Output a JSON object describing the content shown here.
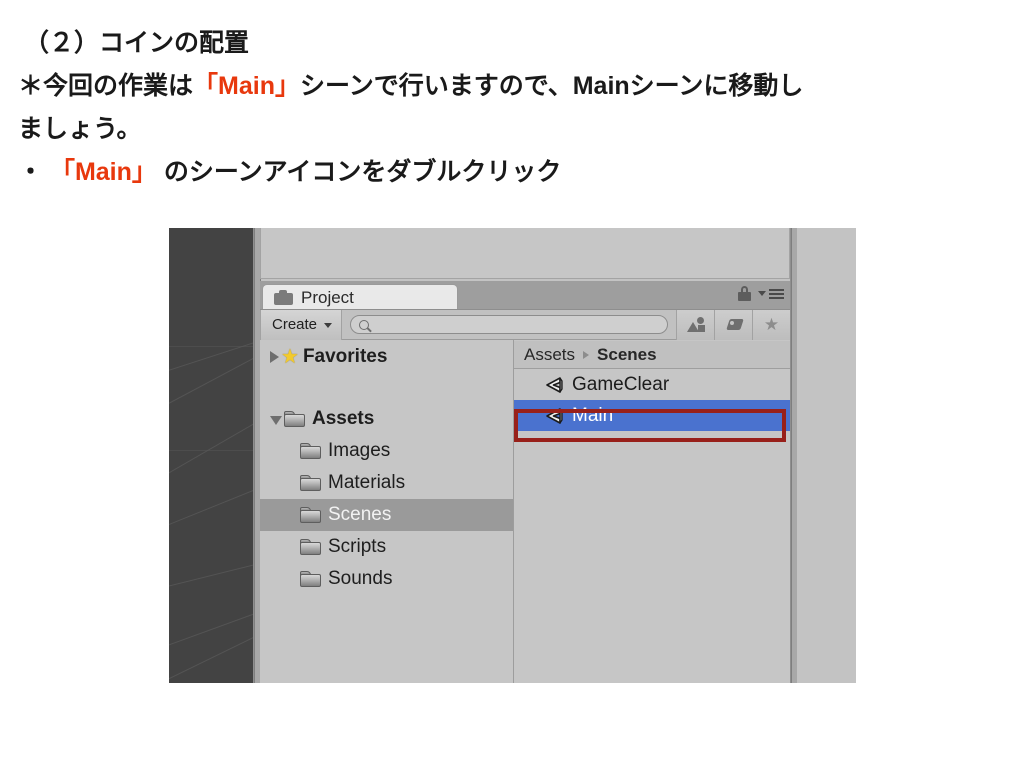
{
  "slide": {
    "lines": [
      {
        "id": "l1",
        "parts": [
          {
            "t": "（２）コインの配置",
            "accent": false
          }
        ]
      },
      {
        "id": "l2",
        "parts": [
          {
            "t": "＊今回の作業は",
            "accent": false
          },
          {
            "t": "「Main」",
            "accent": true
          },
          {
            "t": "シーンで行いますので、Mainシーンに移動し",
            "accent": false
          }
        ]
      },
      {
        "id": "l3",
        "parts": [
          {
            "t": "ましょう。",
            "accent": false
          }
        ]
      },
      {
        "id": "l4",
        "parts": [
          {
            "t": "・ ",
            "accent": false
          },
          {
            "t": "「Main」",
            "accent": true
          },
          {
            "t": " のシーンアイコンをダブルクリック",
            "accent": false
          }
        ]
      }
    ],
    "accent_color": "#e8380d",
    "text_color": "#1a1a1a"
  },
  "unity": {
    "tab": {
      "label": "Project",
      "icon": "folder-icon"
    },
    "window_controls": {
      "lock": "lock-icon",
      "menu": "hamburger-menu-icon"
    },
    "toolbar": {
      "create_label": "Create",
      "search_value": "",
      "search_placeholder": "",
      "filters": [
        {
          "name": "object-type-filter-icon",
          "glyph": "objfilter"
        },
        {
          "name": "label-filter-icon",
          "glyph": "tag"
        },
        {
          "name": "favorite-filter-icon",
          "glyph": "star"
        }
      ]
    },
    "tree": {
      "rows": [
        {
          "label": "Favorites",
          "icon": "star-icon",
          "twisty": "collapsed",
          "indent": 0,
          "bold": true,
          "selected": false
        },
        {
          "label": "",
          "icon": "none",
          "twisty": "none",
          "indent": 0,
          "bold": false,
          "selected": false
        },
        {
          "label": "Assets",
          "icon": "folder-icon",
          "twisty": "expanded",
          "indent": 0,
          "bold": true,
          "selected": false
        },
        {
          "label": "Images",
          "icon": "folder-icon",
          "twisty": "none",
          "indent": 1,
          "bold": false,
          "selected": false
        },
        {
          "label": "Materials",
          "icon": "folder-icon",
          "twisty": "none",
          "indent": 1,
          "bold": false,
          "selected": false
        },
        {
          "label": "Scenes",
          "icon": "folder-icon",
          "twisty": "none",
          "indent": 1,
          "bold": false,
          "selected": true
        },
        {
          "label": "Scripts",
          "icon": "folder-icon",
          "twisty": "none",
          "indent": 1,
          "bold": false,
          "selected": false
        },
        {
          "label": "Sounds",
          "icon": "folder-icon",
          "twisty": "none",
          "indent": 1,
          "bold": false,
          "selected": false
        }
      ]
    },
    "breadcrumb": {
      "root": "Assets",
      "current": "Scenes"
    },
    "list": {
      "items": [
        {
          "label": "GameClear",
          "icon": "unity-scene-icon",
          "selected": false,
          "highlighted": false
        },
        {
          "label": "Main",
          "icon": "unity-scene-icon",
          "selected": true,
          "highlighted": true
        }
      ]
    },
    "colors": {
      "selection_blue": "#4a72cf",
      "highlight_red": "#98201a",
      "panel_gray": "#c6c6c6",
      "tree_selected_gray": "#9a9a9a",
      "sceneview_dark": "#434343"
    }
  }
}
